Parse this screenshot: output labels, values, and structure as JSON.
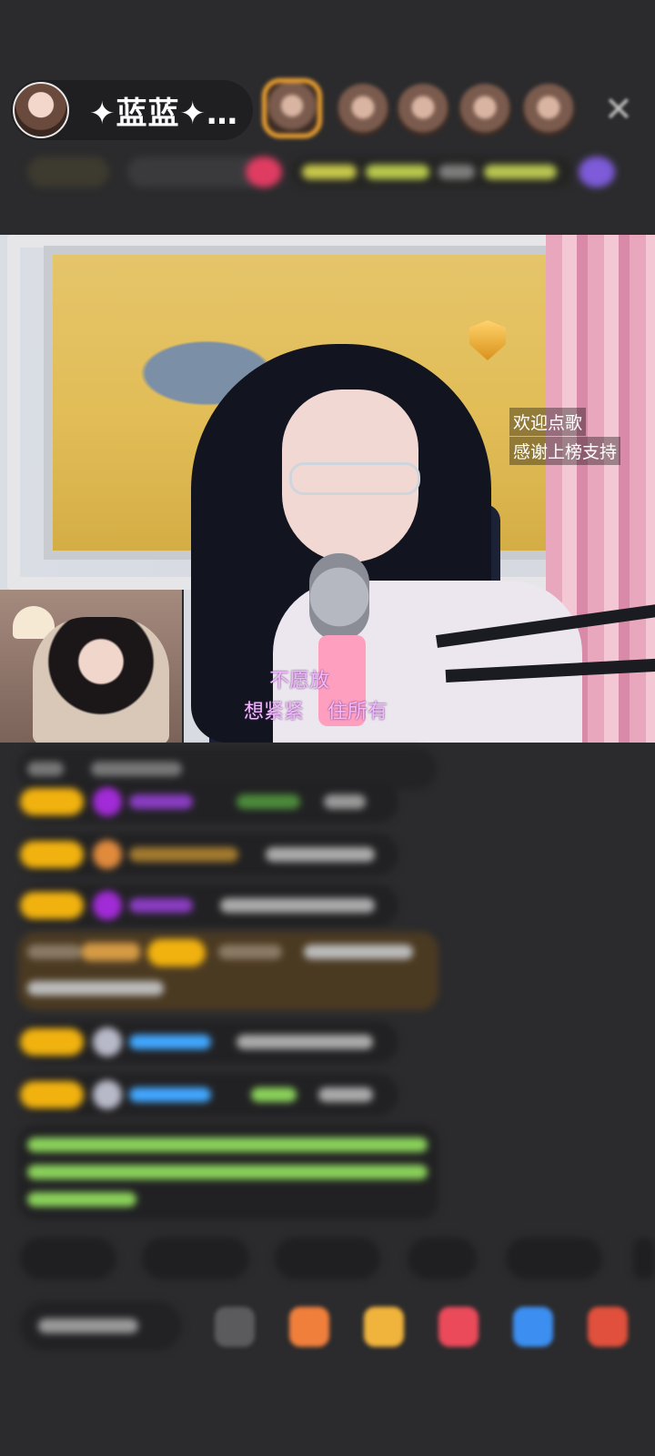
{
  "header": {
    "host_name": "✦蓝蓝✦…",
    "close_symbol": "✕"
  },
  "video": {
    "banner_lines": [
      "欢迎点歌",
      "感谢上榜支持"
    ],
    "lyrics": [
      "不愿放",
      "想紧紧",
      "住所有"
    ]
  },
  "colors": {
    "background": "#2b2b2d",
    "level_badge": "#f1b20f",
    "gem_purple": "#a12bd6",
    "lyric_pink": "#f2b8ff",
    "username_blue": "#41a7ff",
    "system_green": "#8ad15a"
  }
}
